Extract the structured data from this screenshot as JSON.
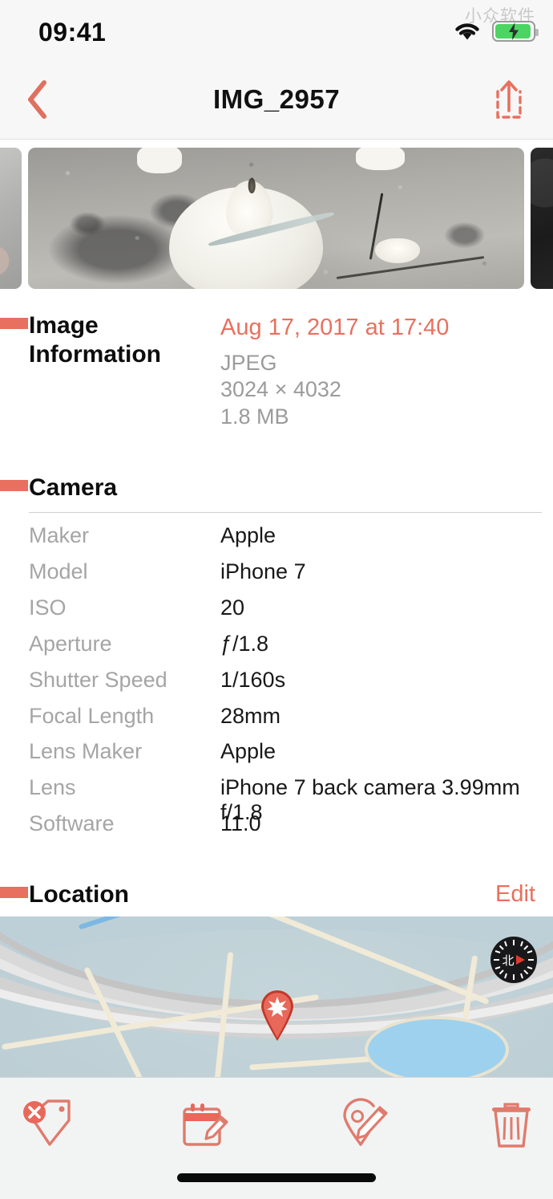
{
  "status_bar": {
    "time": "09:41",
    "watermark": "小众软件",
    "wifi_icon": "wifi-icon",
    "battery_icon": "battery-charging-icon"
  },
  "nav_bar": {
    "back_icon": "chevron-left-icon",
    "title": "IMG_2957",
    "share_icon": "share-upload-icon"
  },
  "photo_strip": {
    "previous_thumb": "photo-thumbnail-previous",
    "current_thumb": "photo-thumbnail-current",
    "next_thumb": "photo-thumbnail-next"
  },
  "image_information": {
    "section_title_line1": "Image",
    "section_title_line2": "Information",
    "date": "Aug 17, 2017 at 17:40",
    "format": "JPEG",
    "dimensions": "3024 × 4032",
    "file_size": "1.8 MB"
  },
  "camera": {
    "section_title": "Camera",
    "rows": [
      {
        "label": "Maker",
        "value": "Apple"
      },
      {
        "label": "Model",
        "value": "iPhone 7"
      },
      {
        "label": "ISO",
        "value": "20"
      },
      {
        "label": "Aperture",
        "value": "ƒ/1.8"
      },
      {
        "label": "Shutter Speed",
        "value": "1/160s"
      },
      {
        "label": "Focal Length",
        "value": "28mm"
      },
      {
        "label": "Lens Maker",
        "value": "Apple"
      },
      {
        "label": "Lens",
        "value": "iPhone 7 back camera 3.99mm f/1.8"
      },
      {
        "label": "Software",
        "value": "11.0"
      }
    ]
  },
  "location": {
    "section_title": "Location",
    "edit_label": "Edit",
    "map_pin_icon": "map-pin-icon",
    "compass_icon": "compass-icon",
    "compass_label": "北"
  },
  "toolbar": {
    "buttons": [
      {
        "name": "remove-tag-button",
        "icon": "tag-remove-icon"
      },
      {
        "name": "edit-date-button",
        "icon": "calendar-edit-icon"
      },
      {
        "name": "edit-location-button",
        "icon": "location-edit-icon"
      },
      {
        "name": "delete-button",
        "icon": "trash-icon"
      }
    ]
  },
  "colors": {
    "accent": "#e8705f",
    "label_gray": "#a5a5a5",
    "value_dark": "#181818",
    "chrome_bg": "#f7f7f7",
    "toolbar_bg": "#f2f4f4",
    "battery_green": "#4cd562"
  }
}
